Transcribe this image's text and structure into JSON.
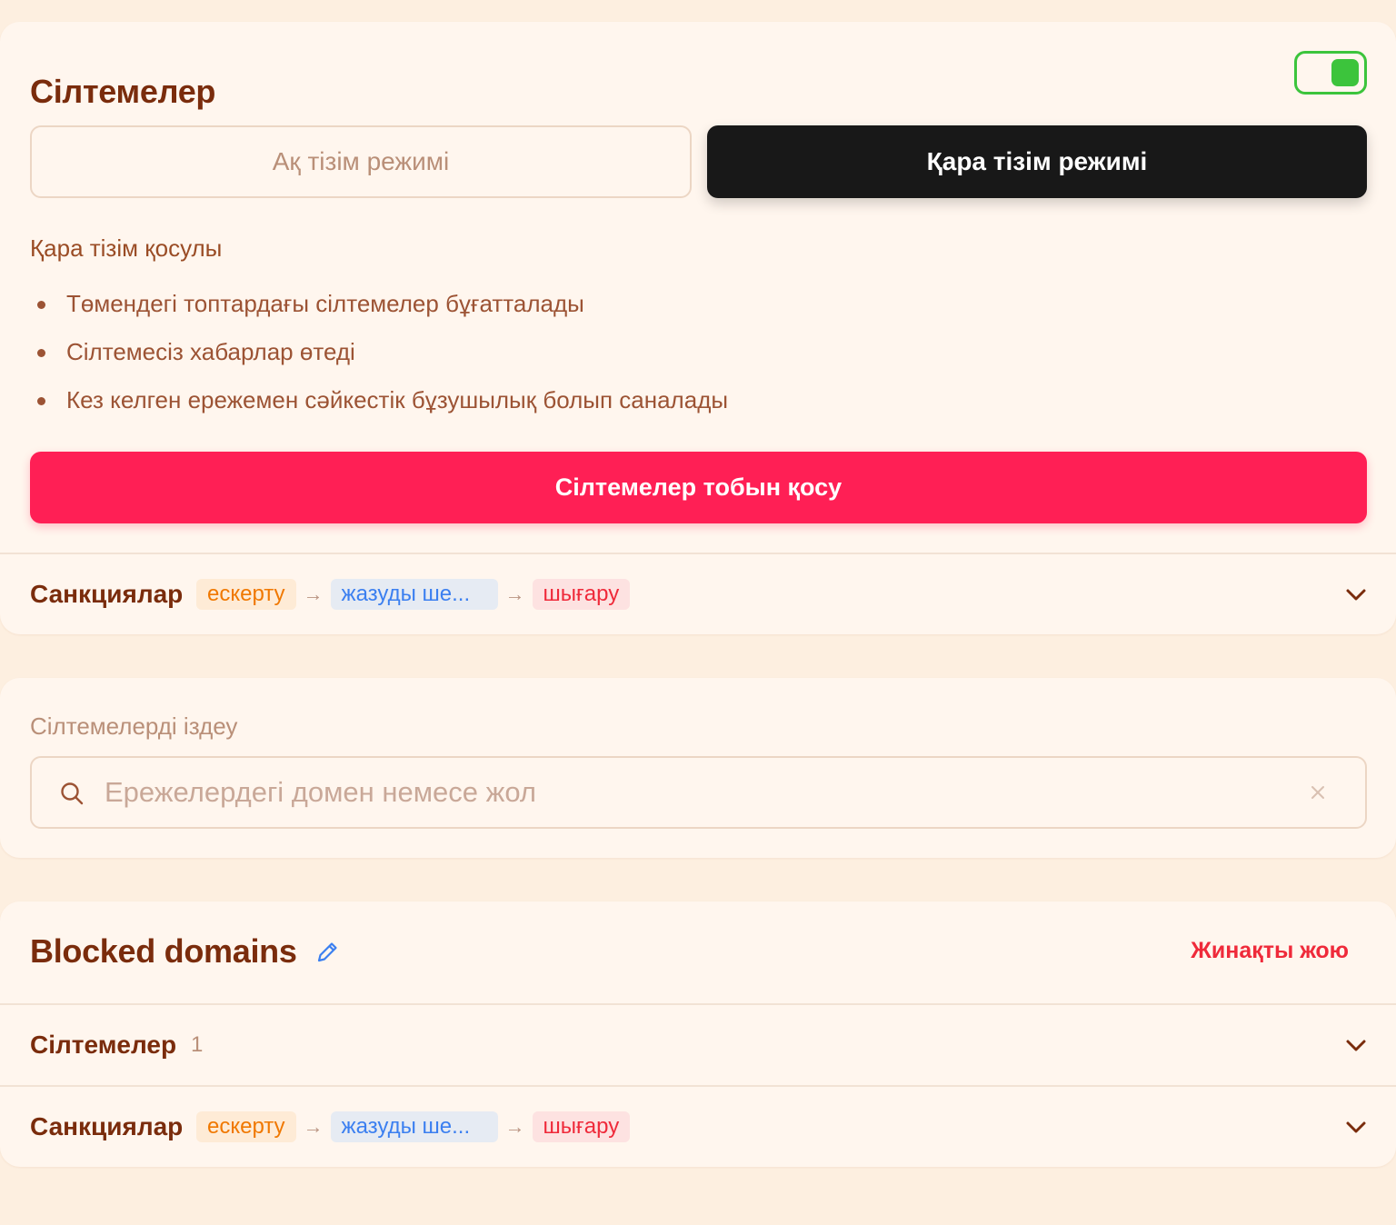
{
  "links_card": {
    "title": "Сілтемелер",
    "toggle_on": true,
    "mode_whitelist": "Ақ тізім режимі",
    "mode_blacklist": "Қара тізім режимі",
    "active_mode": "blacklist",
    "status": "Қара тізім қосулы",
    "bullets": [
      "Төмендегі топтардағы сілтемелер бұғатталады",
      "Сілтемесіз хабарлар өтеді",
      "Кез келген ережемен сәйкестік бұзушылық болып саналады"
    ],
    "add_group_button": "Сілтемелер тобын қосу",
    "sanctions": {
      "label": "Санкциялар",
      "steps": [
        "ескерту",
        "жазуды ше...",
        "шығару"
      ]
    }
  },
  "search_card": {
    "label": "Сілтемелерді іздеу",
    "placeholder": "Ережелердегі домен немесе жол",
    "value": ""
  },
  "collection_card": {
    "title": "Blocked domains",
    "delete_button": "Жинақты жою",
    "links_row": {
      "label": "Сілтемелер",
      "count": "1"
    },
    "sanctions": {
      "label": "Санкциялар",
      "steps": [
        "ескерту",
        "жазуды ше...",
        "шығару"
      ]
    }
  },
  "colors": {
    "accent_red": "#ff1f55",
    "toggle_green": "#3cc43c",
    "text_brown": "#7a2c0c",
    "chip_warn": "#f07800",
    "chip_mute": "#3b7ff0",
    "chip_kick": "#ef2a3a"
  },
  "icons": {
    "search": "search-icon",
    "clear": "close-icon",
    "edit": "pencil-icon",
    "expand": "chevron-down-icon",
    "step_separator": "arrow-right-icon"
  }
}
